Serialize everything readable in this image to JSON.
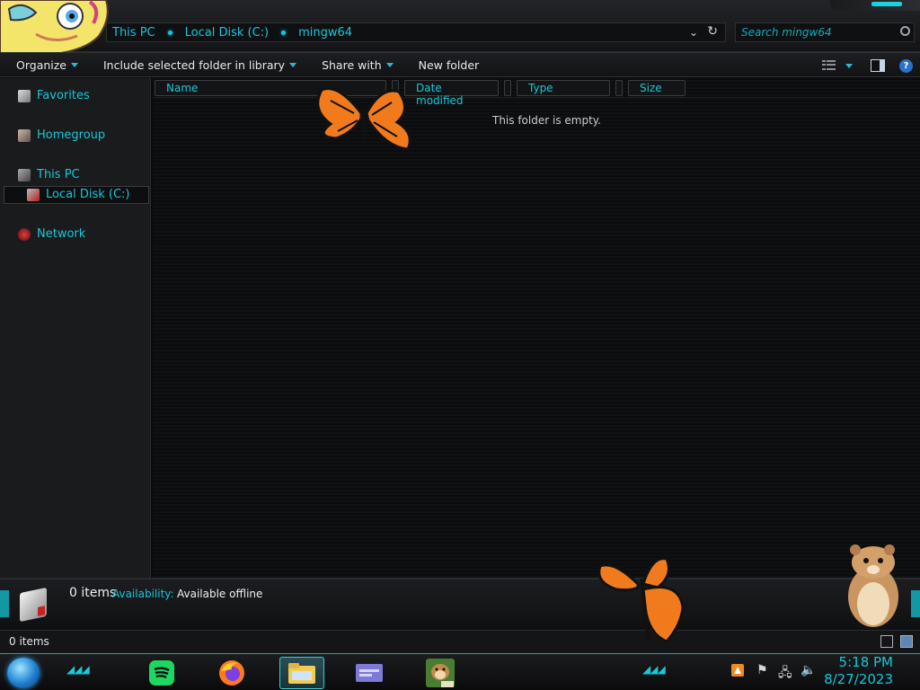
{
  "address": {
    "crumbs": [
      "This PC",
      "Local Disk (C:)",
      "mingw64"
    ]
  },
  "search": {
    "placeholder": "Search mingw64"
  },
  "toolbar": {
    "organize": "Organize",
    "include_library": "Include selected folder in library",
    "share_with": "Share with",
    "new_folder": "New folder"
  },
  "nav": {
    "favorites": "Favorites",
    "homegroup": "Homegroup",
    "this_pc": "This PC",
    "local_disk": "Local Disk (C:)",
    "network": "Network"
  },
  "columns": {
    "name": "Name",
    "date_modified": "Date modified",
    "type": "Type",
    "size": "Size"
  },
  "content": {
    "empty_message": "This folder is empty."
  },
  "details": {
    "items": "0 items",
    "availability_label": "Availability:",
    "availability_value": "Available offline"
  },
  "status": {
    "count": "0 items"
  },
  "clock": {
    "time": "5:18 PM",
    "date": "8/27/2023"
  },
  "colors": {
    "accent": "#16c7d8",
    "background": "#0b0c0d"
  }
}
